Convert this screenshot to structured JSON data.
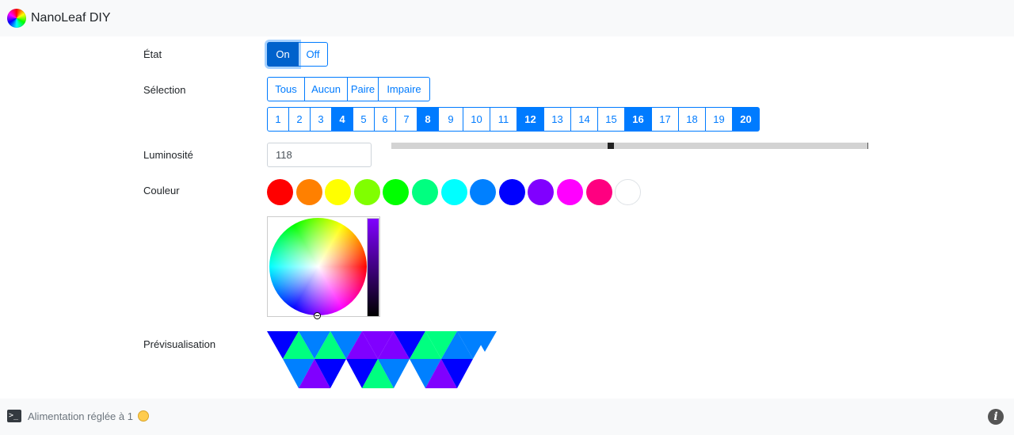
{
  "app": {
    "title": "NanoLeaf DIY"
  },
  "state": {
    "label": "État",
    "on_label": "On",
    "off_label": "Off"
  },
  "selection": {
    "label": "Sélection",
    "modes": [
      "Tous",
      "Aucun",
      "Paire",
      "Impaire"
    ],
    "panels": [
      "1",
      "2",
      "3",
      "4",
      "5",
      "6",
      "7",
      "8",
      "9",
      "10",
      "11",
      "12",
      "13",
      "14",
      "15",
      "16",
      "17",
      "18",
      "19",
      "20"
    ],
    "selected": [
      "4",
      "8",
      "12",
      "16",
      "20"
    ]
  },
  "brightness": {
    "label": "Luminosité",
    "value": "118",
    "slider_fraction": 0.46
  },
  "color": {
    "label": "Couleur",
    "swatches": [
      "#ff0000",
      "#ff8000",
      "#ffff00",
      "#80ff00",
      "#00ff00",
      "#00ff80",
      "#00ffff",
      "#0080ff",
      "#0000ff",
      "#8000ff",
      "#ff00ff",
      "#ff0080",
      "#ffffff"
    ],
    "selected_value_color": "#8000ff"
  },
  "preview": {
    "label": "Prévisualisation"
  },
  "footer": {
    "status": "Alimentation réglée à 1",
    "terminal_icon": "terminal-icon",
    "info_icon": "info-icon",
    "status_icon": "smiley-icon"
  },
  "colors": {
    "accent": "#007bff",
    "preview_blue": "#0000ff",
    "preview_azure": "#0080ff",
    "preview_violet": "#8000ff",
    "preview_green": "#00ff80"
  }
}
